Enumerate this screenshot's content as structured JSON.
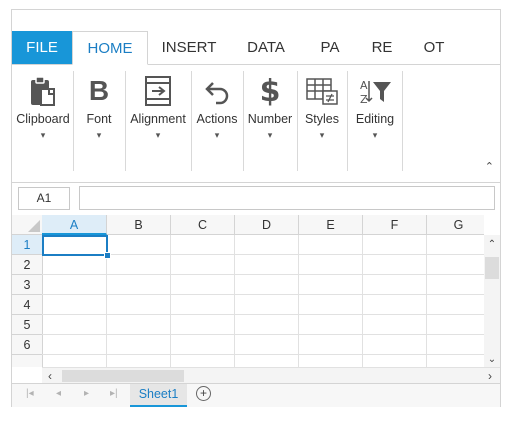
{
  "ribbon_tabs": [
    "FILE",
    "HOME",
    "INSERT",
    "DATA",
    "PA",
    "RE",
    "OT"
  ],
  "groups": {
    "clipboard": "Clipboard",
    "font": "Font",
    "alignment": "Alignment",
    "actions": "Actions",
    "number": "Number",
    "styles": "Styles",
    "editing": "Editing"
  },
  "caret": "▾",
  "collapse": "⌃",
  "name_box": "A1",
  "columns": [
    "A",
    "B",
    "C",
    "D",
    "E",
    "F",
    "G"
  ],
  "rows": [
    "1",
    "2",
    "3",
    "4",
    "5",
    "6"
  ],
  "sheet": {
    "name": "Sheet1",
    "add": "+"
  },
  "nav": [
    "|◂",
    "◂",
    "▸",
    "▸|"
  ],
  "scroll": {
    "up": "⌃",
    "down": "⌄",
    "left": "‹",
    "right": "›"
  },
  "colors": {
    "accent": "#1896d8",
    "active_text": "#1b7ec4"
  }
}
